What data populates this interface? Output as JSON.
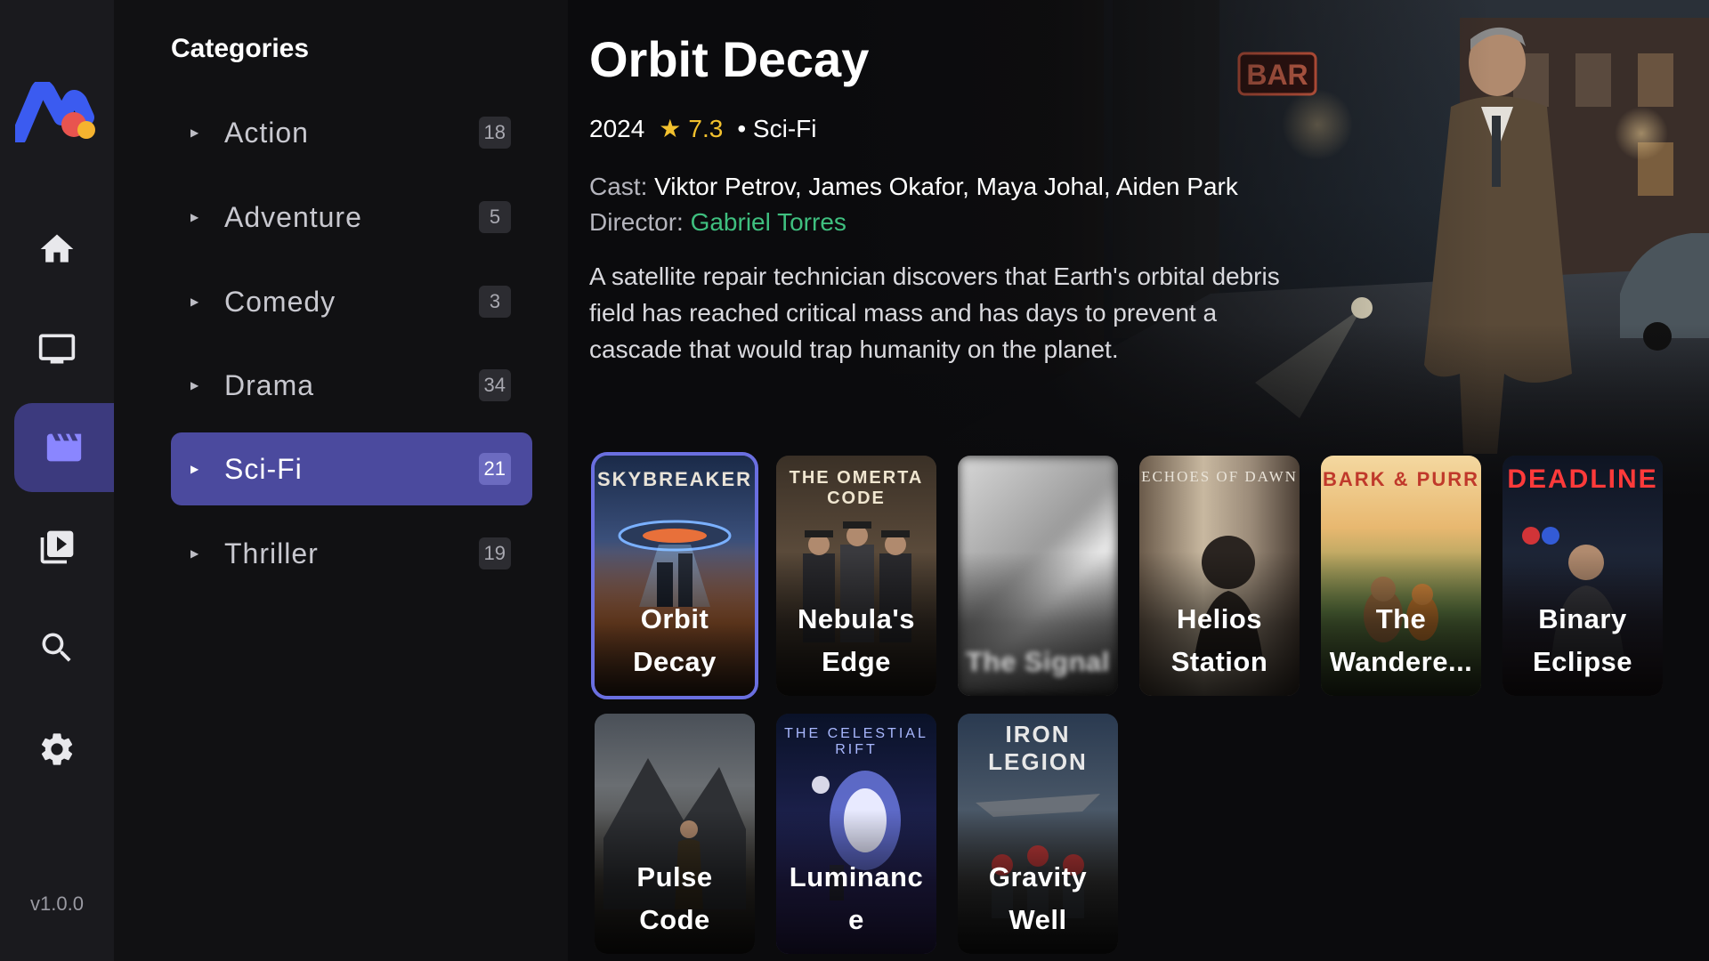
{
  "app": {
    "version": "v1.0.0"
  },
  "nav": [
    {
      "name": "home-icon",
      "active": false
    },
    {
      "name": "tv-icon",
      "active": false
    },
    {
      "name": "movies-icon",
      "active": true
    },
    {
      "name": "video-library-icon",
      "active": false
    },
    {
      "name": "search-icon",
      "active": false
    },
    {
      "name": "settings-icon",
      "active": false
    }
  ],
  "categories": {
    "title": "Categories",
    "items": [
      {
        "label": "Action",
        "count": "18",
        "active": false
      },
      {
        "label": "Adventure",
        "count": "5",
        "active": false
      },
      {
        "label": "Comedy",
        "count": "3",
        "active": false
      },
      {
        "label": "Drama",
        "count": "34",
        "active": false
      },
      {
        "label": "Sci-Fi",
        "count": "21",
        "active": true
      },
      {
        "label": "Thriller",
        "count": "19",
        "active": false
      }
    ]
  },
  "featured": {
    "title": "Orbit Decay",
    "year": "2024",
    "rating": "7.3",
    "genre": "• Sci-Fi",
    "cast_label": "Cast:",
    "cast": "Viktor Petrov, James Okafor, Maya Johal, Aiden Park",
    "director_label": "Director:",
    "director": "Gabriel Torres",
    "synopsis": "A satellite repair technician discovers that Earth's orbital debris field has reached critical mass and has days to prevent a cascade that would trap humanity on the planet.",
    "hero_sign": "BAR"
  },
  "posters": [
    {
      "name": "Orbit Decay",
      "poster_title": "SKYBREAKER",
      "selected": true,
      "blurred": false,
      "accent": "#e0803a"
    },
    {
      "name": "Nebula's Edge",
      "poster_title": "THE OMERTA CODE",
      "selected": false,
      "blurred": false,
      "accent": "#d9302a"
    },
    {
      "name": "The Signal",
      "poster_title": "",
      "selected": false,
      "blurred": true,
      "accent": "#cfcfcf"
    },
    {
      "name": "Helios Station",
      "poster_title": "ECHOES OF DAWN",
      "selected": false,
      "blurred": false,
      "accent": "#d8c8b0"
    },
    {
      "name": "The Wandere...",
      "poster_title": "BARK & PURR",
      "selected": false,
      "blurred": false,
      "accent": "#c0392b"
    },
    {
      "name": "Binary Eclipse",
      "poster_title": "DEADLINE",
      "selected": false,
      "blurred": false,
      "accent": "#e23030"
    },
    {
      "name": "Pulse Code",
      "poster_title": "",
      "selected": false,
      "blurred": false,
      "accent": "#8a7a60"
    },
    {
      "name": "Luminance",
      "poster_title": "THE CELESTIAL RIFT",
      "selected": false,
      "blurred": false,
      "accent": "#a9b8ff"
    },
    {
      "name": "Gravity Well",
      "poster_title": "IRON LEGION",
      "selected": false,
      "blurred": false,
      "accent": "#d8d8d8"
    }
  ],
  "colors": {
    "accent": "#4b4a9e",
    "rating": "#f2c12e",
    "director": "#3fbf7f"
  }
}
